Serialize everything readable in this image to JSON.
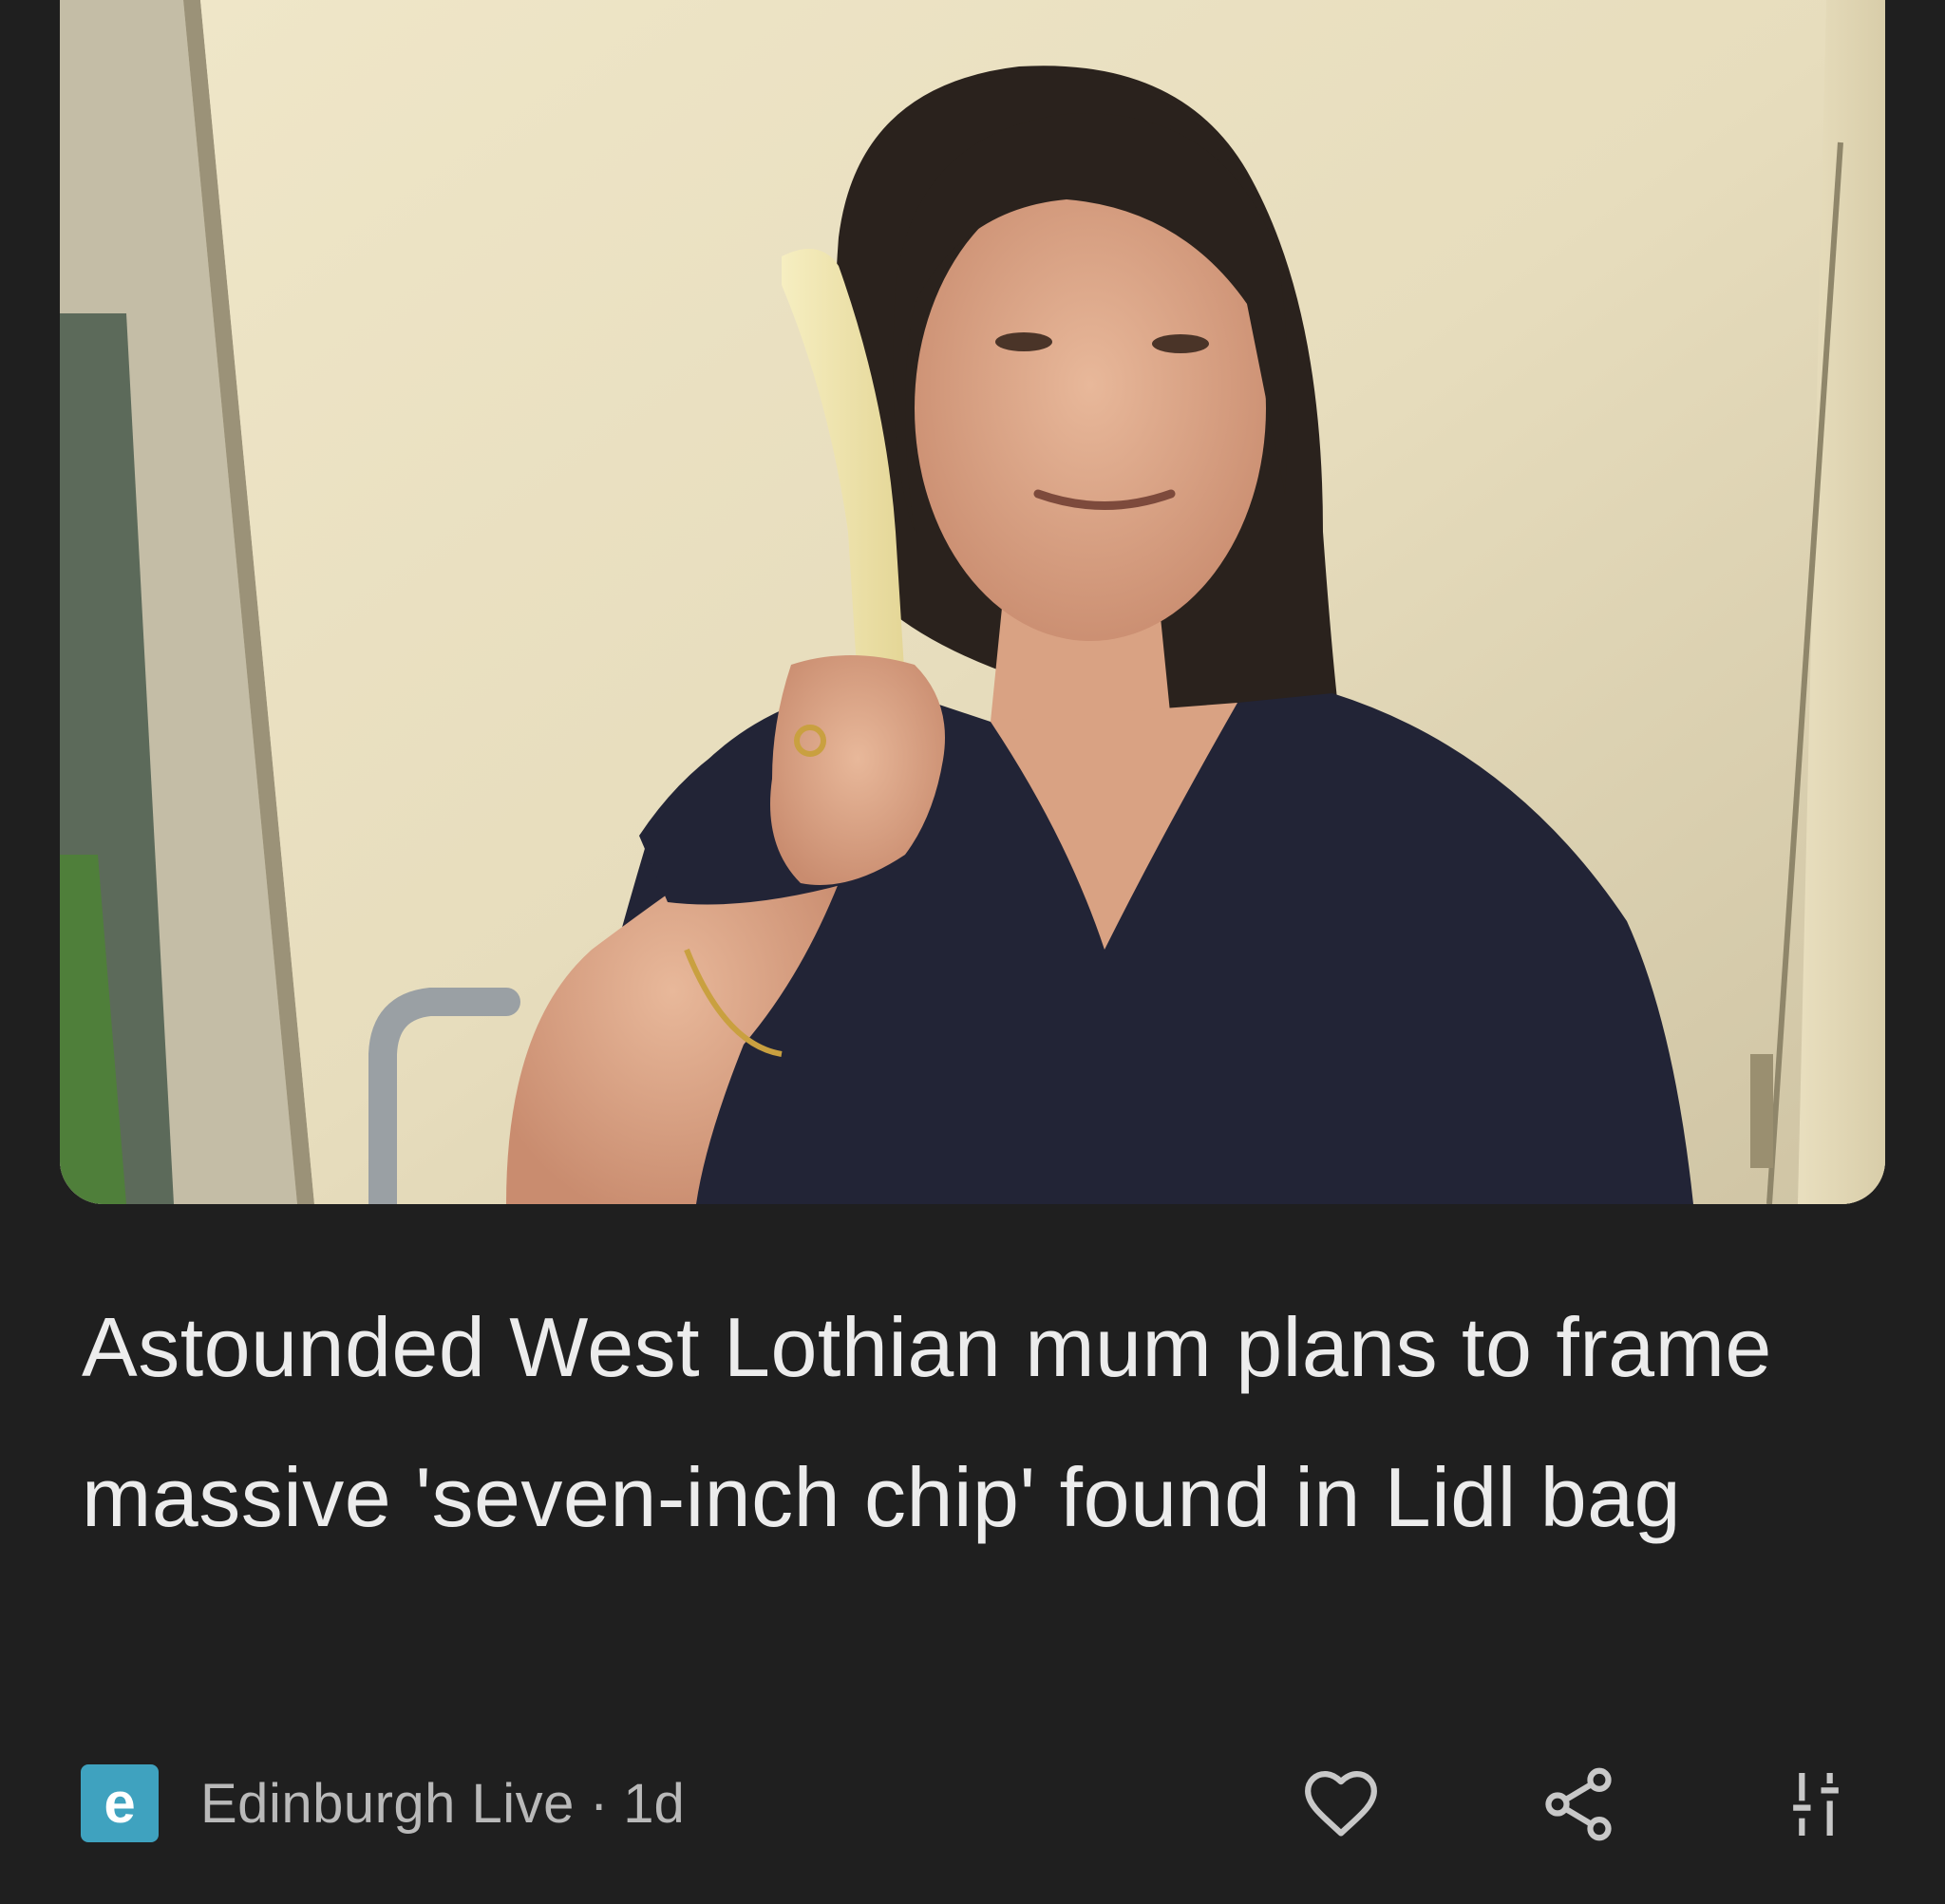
{
  "article": {
    "headline": "Astounded West Lothian mum plans to frame massive 'seven-inch chip' found in Lidl bag",
    "image_alt": "Woman holding up a long chip"
  },
  "source": {
    "logo_letter": "e",
    "name": "Edinburgh Live",
    "separator": "·",
    "age": "1d"
  },
  "actions": {
    "like_icon": "heart-outline-icon",
    "share_icon": "share-icon",
    "more_icon": "sliders-icon"
  },
  "colors": {
    "background": "#1f1f1f",
    "headline_text": "#ececec",
    "meta_text": "#b9b9b9",
    "logo_bg": "#3fa2bf",
    "icon_stroke": "#c8c8c8"
  }
}
